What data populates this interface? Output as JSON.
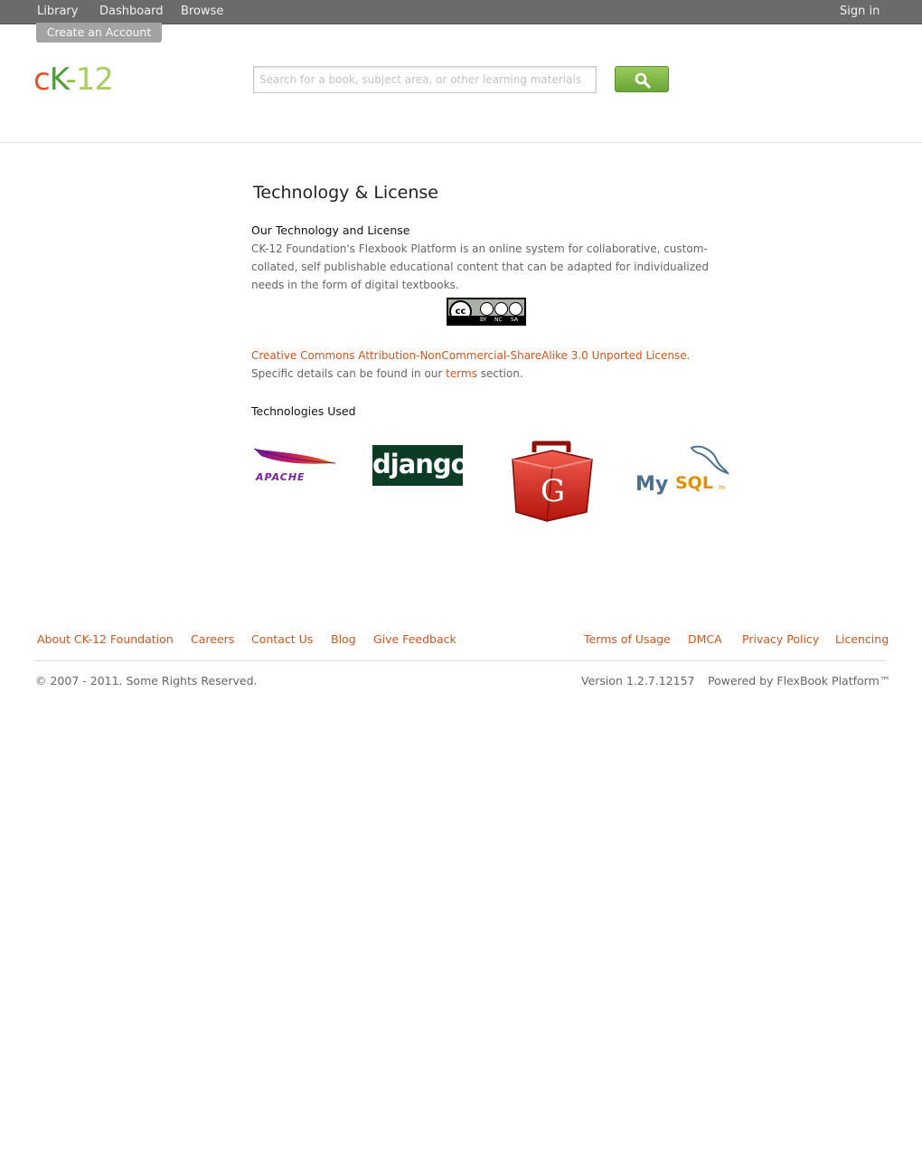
{
  "topbar": {
    "library": "Library",
    "dashboard": "Dashboard",
    "browse": "Browse",
    "sign_in": "Sign in",
    "create_account": "Create an Account"
  },
  "logo": {
    "c": "c",
    "k": "K",
    "dash": "-",
    "num": "12"
  },
  "search": {
    "placeholder": "Search for a book, subject area, or other learning materials"
  },
  "page": {
    "title": "Technology & License",
    "section1_heading": "Our Technology and License",
    "section1_text": "CK-12 Foundation's Flexbook Platform is an online system for collaborative, custom-collated, self publishable educational content that can be adapted for individualized needs in the form of digital textbooks.",
    "cc_badge": {
      "cc": "cc",
      "by": "BY",
      "nc": "NC",
      "sa": "SA"
    },
    "license_link": "Creative Commons Attribution-NonCommercial-ShareAlike 3.0 Unported License.",
    "license_text_1": " Specific details can be found in our ",
    "terms_link": "terms",
    "license_text_2": " section.",
    "section2_heading": "Technologies Used",
    "tech_logos": {
      "apache": "APACHE",
      "django": "django",
      "gwt": "G",
      "mysql_my": "My",
      "mysql_sql": "SQL",
      "mysql_tm": "TM"
    }
  },
  "footer": {
    "links_left": [
      "About CK-12 Foundation",
      "Careers",
      "Contact Us",
      "Blog",
      "Give Feedback"
    ],
    "links_right": [
      "Terms of Usage",
      "DMCA",
      "Privacy Policy",
      "Licencing"
    ],
    "copyright": "© 2007 - 2011. Some Rights Reserved.",
    "version": "Version 1.2.7.12157",
    "powered_by": "Powered by FlexBook Platform™"
  },
  "colors": {
    "link": "#d5541b",
    "topbar": "#6b6b6b",
    "search_button": "#7fb845"
  },
  "icons": {
    "search_button": "magnifier-icon"
  }
}
